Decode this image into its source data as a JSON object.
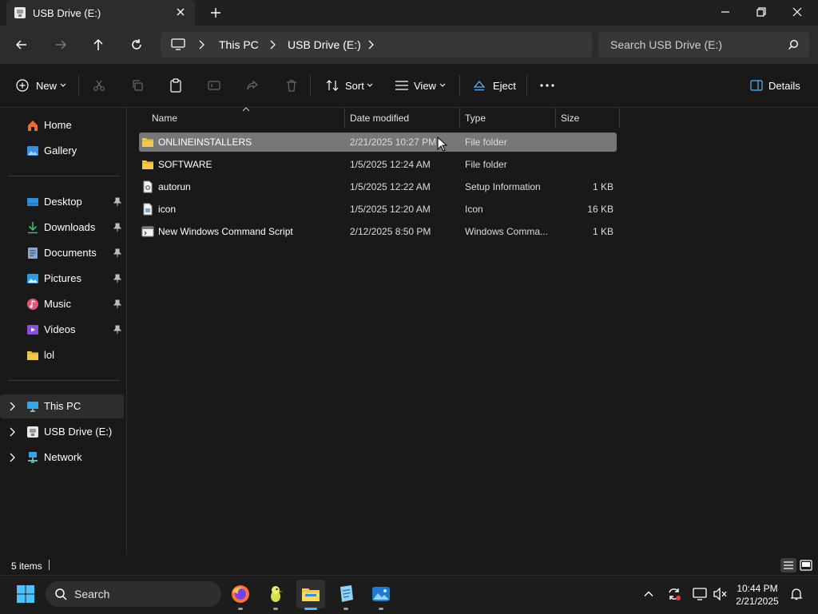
{
  "window": {
    "tab_title": "USB Drive (E:)"
  },
  "address": {
    "segments": [
      "This PC",
      "USB Drive (E:)"
    ],
    "search_placeholder": "Search USB Drive (E:)"
  },
  "commands": {
    "new": "New",
    "sort": "Sort",
    "view": "View",
    "eject": "Eject",
    "details": "Details"
  },
  "sidebar": {
    "items": [
      {
        "label": "Home",
        "icon": "home-icon"
      },
      {
        "label": "Gallery",
        "icon": "gallery-icon"
      },
      {
        "label": "Desktop",
        "icon": "desktop-icon",
        "pinned": true
      },
      {
        "label": "Downloads",
        "icon": "downloads-icon",
        "pinned": true
      },
      {
        "label": "Documents",
        "icon": "documents-icon",
        "pinned": true
      },
      {
        "label": "Pictures",
        "icon": "pictures-icon",
        "pinned": true
      },
      {
        "label": "Music",
        "icon": "music-icon",
        "pinned": true
      },
      {
        "label": "Videos",
        "icon": "videos-icon",
        "pinned": true
      },
      {
        "label": "lol",
        "icon": "folder-icon"
      },
      {
        "label": "This PC",
        "icon": "this-pc-icon",
        "selected": true
      },
      {
        "label": "USB Drive (E:)",
        "icon": "usb-drive-icon"
      },
      {
        "label": "Network",
        "icon": "network-icon"
      }
    ]
  },
  "columns": {
    "name": "Name",
    "date": "Date modified",
    "type": "Type",
    "size": "Size"
  },
  "files": [
    {
      "name": "ONLINEINSTALLERS",
      "date": "2/21/2025 10:27 PM",
      "type": "File folder",
      "size": "",
      "icon": "folder-icon",
      "selected": true
    },
    {
      "name": "SOFTWARE",
      "date": "1/5/2025 12:24 AM",
      "type": "File folder",
      "size": "",
      "icon": "folder-icon"
    },
    {
      "name": "autorun",
      "date": "1/5/2025 12:22 AM",
      "type": "Setup Information",
      "size": "1 KB",
      "icon": "setup-info-icon"
    },
    {
      "name": "icon",
      "date": "1/5/2025 12:20 AM",
      "type": "Icon",
      "size": "16 KB",
      "icon": "icon-file-icon"
    },
    {
      "name": "New Windows Command Script",
      "date": "2/12/2025 8:50 PM",
      "type": "Windows Comma...",
      "size": "1 KB",
      "icon": "cmd-script-icon"
    }
  ],
  "status": {
    "item_count": "5 items"
  },
  "taskbar": {
    "search_label": "Search",
    "time": "10:44 PM",
    "date": "2/21/2025"
  },
  "colors": {
    "accent": "#5fb2f2",
    "folder": "#f2c94c",
    "selection": "#777777"
  }
}
